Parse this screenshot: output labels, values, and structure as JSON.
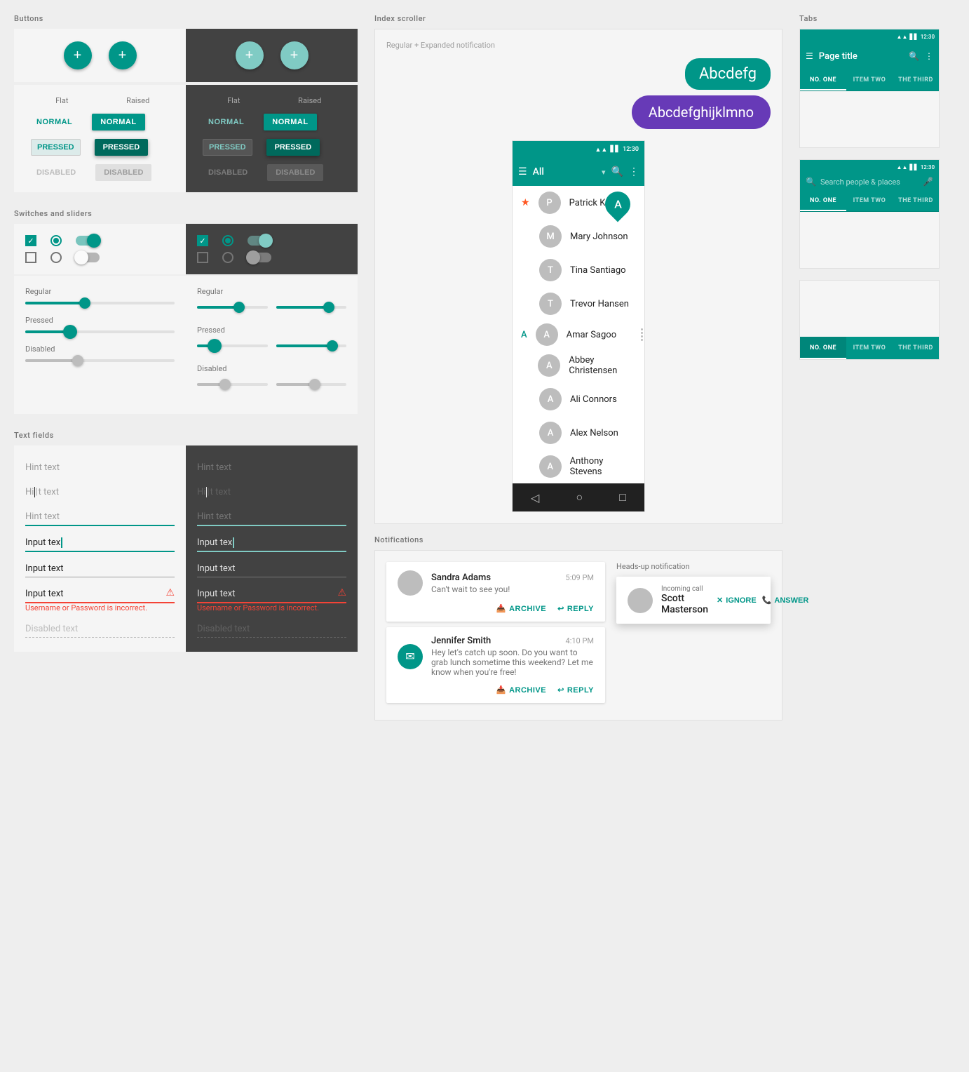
{
  "sections": {
    "buttons_label": "Buttons",
    "switches_label": "Switches and sliders",
    "textfields_label": "Text fields",
    "index_scroller_label": "Index scroller",
    "tabs_label": "Tabs",
    "notifications_label": "Notifications"
  },
  "buttons": {
    "fab_icon": "+",
    "flat_label": "Flat",
    "raised_label": "Raised",
    "normal": "NORMAL",
    "pressed": "PRESSED",
    "disabled": "DISABLED"
  },
  "index_scroller": {
    "notif_label": "Regular + Expanded notification",
    "bubble1": "Abcdefg",
    "bubble2": "Abcdefghijklmno",
    "toolbar_title": "All",
    "contacts": [
      {
        "name": "Patrick Keenan",
        "initial": "P"
      },
      {
        "name": "Mary Johnson",
        "initial": "M"
      },
      {
        "name": "Tina Santiago",
        "initial": "T"
      },
      {
        "name": "Trevor Hansen",
        "initial": "T"
      },
      {
        "name": "Amar Sagoo",
        "initial": "A"
      },
      {
        "name": "Abbey Christensen",
        "initial": "A"
      },
      {
        "name": "Ali Connors",
        "initial": "A"
      },
      {
        "name": "Alex Nelson",
        "initial": "A"
      },
      {
        "name": "Anthony Stevens",
        "initial": "A"
      }
    ],
    "big_letter": "A",
    "index_letter": "A",
    "nav_back": "◁",
    "nav_home": "○",
    "nav_recent": "□"
  },
  "tabs": {
    "title": "Page title",
    "tab1": "NO. ONE",
    "tab2": "ITEM TWO",
    "tab3": "THE THIRD",
    "search_placeholder": "Search people & places",
    "time": "12:30"
  },
  "notifications": {
    "regular_label": "Heads-up notification",
    "notif1": {
      "name": "Sandra Adams",
      "time": "5:09 PM",
      "message": "Can't wait to see you!",
      "actions": [
        "ARCHIVE",
        "REPLY"
      ]
    },
    "notif2": {
      "name": "Jennifer Smith",
      "time": "4:10 PM",
      "message": "Hey let's catch up soon. Do you want to grab lunch sometime this weekend? Let me know when you're free!",
      "icon": "✉",
      "actions": [
        "ARCHIVE",
        "REPLY"
      ]
    },
    "headsup": {
      "subtitle": "Incoming call",
      "name": "Scott Masterson",
      "actions": [
        "IGNORE",
        "ANSWER"
      ]
    }
  },
  "textfields": {
    "hint": "Hint text",
    "hint_focused": "Hi|t text",
    "hint_empty": "Hint text",
    "input_active": "Input tex|",
    "input_filled": "Input text",
    "input_error": "Input text",
    "error_msg": "Username or Password is incorrect.",
    "disabled": "Disabled text"
  }
}
